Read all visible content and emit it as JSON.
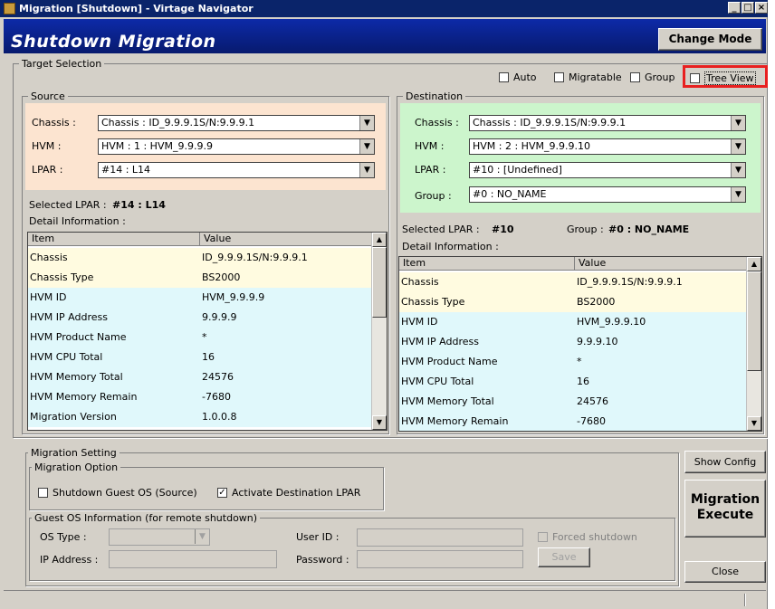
{
  "window": {
    "title": "Migration [Shutdown] - Virtage Navigator"
  },
  "header": {
    "title": "Shutdown Migration",
    "change_mode": "Change Mode"
  },
  "target_selection": {
    "legend": "Target Selection",
    "options": {
      "auto": "Auto",
      "migratable": "Migratable",
      "group": "Group",
      "tree_view": "Tree View"
    }
  },
  "source": {
    "legend": "Source",
    "chassis_label": "Chassis :",
    "chassis_value": "Chassis : ID_9.9.9.1S/N:9.9.9.1",
    "hvm_label": "HVM :",
    "hvm_value": "HVM : 1 : HVM_9.9.9.9",
    "lpar_label": "LPAR :",
    "lpar_value": "#14 : L14",
    "selected_label": "Selected LPAR :",
    "selected_value": "#14 : L14",
    "detail_label": "Detail Information :",
    "columns": [
      "Item",
      "Value"
    ],
    "rows": [
      [
        "Chassis",
        "ID_9.9.9.1S/N:9.9.9.1"
      ],
      [
        "Chassis Type",
        "BS2000"
      ],
      [
        "HVM ID",
        "HVM_9.9.9.9"
      ],
      [
        "HVM IP Address",
        "9.9.9.9"
      ],
      [
        "HVM Product Name",
        "*"
      ],
      [
        "HVM CPU Total",
        "16"
      ],
      [
        "HVM Memory Total",
        "24576"
      ],
      [
        "HVM Memory Remain",
        "-7680"
      ],
      [
        "Migration Version",
        "1.0.0.8"
      ]
    ]
  },
  "destination": {
    "legend": "Destination",
    "chassis_label": "Chassis :",
    "chassis_value": "Chassis : ID_9.9.9.1S/N:9.9.9.1",
    "hvm_label": "HVM :",
    "hvm_value": "HVM : 2 : HVM_9.9.9.10",
    "lpar_label": "LPAR :",
    "lpar_value": "#10 : [Undefined]",
    "group_label": "Group :",
    "group_value": "#0 : NO_NAME",
    "selected_label": "Selected LPAR :",
    "selected_value": "#10",
    "selected_group_label": "Group :",
    "selected_group_value": "#0 : NO_NAME",
    "detail_label": "Detail Information :",
    "columns": [
      "Item",
      "Value"
    ],
    "rows": [
      [
        "Chassis",
        "ID_9.9.9.1S/N:9.9.9.1"
      ],
      [
        "Chassis Type",
        "BS2000"
      ],
      [
        "HVM ID",
        "HVM_9.9.9.10"
      ],
      [
        "HVM IP Address",
        "9.9.9.10"
      ],
      [
        "HVM Product Name",
        "*"
      ],
      [
        "HVM CPU Total",
        "16"
      ],
      [
        "HVM Memory Total",
        "24576"
      ],
      [
        "HVM Memory Remain",
        "-7680"
      ]
    ]
  },
  "migration_setting": {
    "legend": "Migration Setting",
    "option_legend": "Migration Option",
    "shutdown_guest_os": "Shutdown Guest OS (Source)",
    "activate_destination": "Activate Destination LPAR",
    "guest_legend": "Guest OS Information (for remote shutdown)",
    "os_type_label": "OS Type :",
    "ip_address_label": "IP Address :",
    "user_id_label": "User ID :",
    "password_label": "Password :",
    "forced_shutdown": "Forced shutdown",
    "save": "Save"
  },
  "buttons": {
    "show_config": "Show Config",
    "migration_execute_1": "Migration",
    "migration_execute_2": "Execute",
    "close": "Close"
  },
  "colors": {
    "source_bg": "#fce4d0",
    "destination_bg": "#ccf5cc",
    "highlight": "#e82020",
    "header_blue": "#0a246a",
    "row_yellow": "#fffbe0",
    "row_cyan": "#e0f8fb"
  }
}
